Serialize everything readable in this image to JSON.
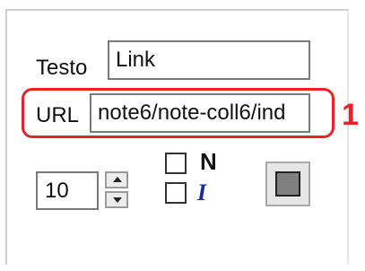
{
  "form": {
    "text_label": "Testo",
    "text_value": "Link",
    "url_label": "URL",
    "url_value": "note6/note-coll6/ind"
  },
  "callout": {
    "number": "1",
    "color": "#e8212b"
  },
  "font_size": {
    "value": "10"
  },
  "style": {
    "bold_label": "N",
    "italic_label": "I",
    "bold_checked": false,
    "italic_checked": false
  },
  "color_picker": {
    "current_color": "#808080"
  }
}
